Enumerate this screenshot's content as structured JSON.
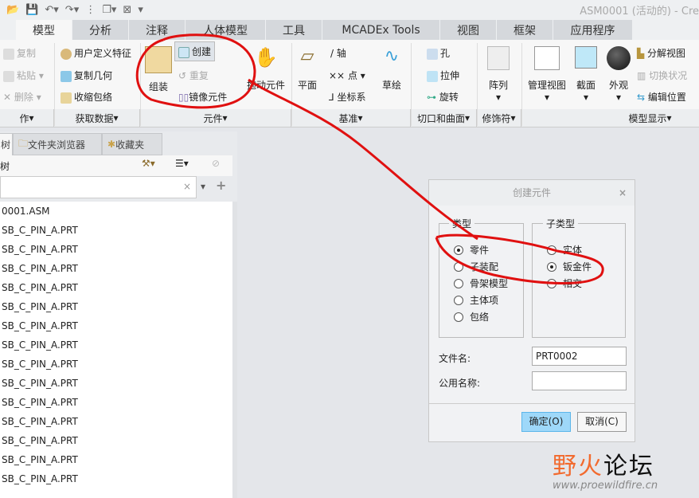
{
  "window": {
    "title": "ASM0001 (活动的) - Cre"
  },
  "tabs": [
    "模型",
    "分析",
    "注释",
    "人体模型",
    "工具",
    "MCADEx Tools",
    "视图",
    "框架",
    "应用程序"
  ],
  "ribbon": {
    "operations": {
      "copy": "复制",
      "paste": "粘贴",
      "delete": "删除",
      "footer": "作"
    },
    "get_data": {
      "udf": "用户定义特征",
      "copy_geom": "复制几何",
      "shrinkwrap": "收缩包络",
      "footer": "获取数据"
    },
    "component": {
      "assemble": "组装",
      "create": "创建",
      "repeat": "重复",
      "mirror": "镜像元件",
      "drag": "拖动元件",
      "footer": "元件"
    },
    "datum": {
      "plane": "平面",
      "axis": "轴",
      "point": "点",
      "csys": "坐标系",
      "sketch": "草绘",
      "footer": "基准"
    },
    "cut": {
      "hole": "孔",
      "extrude": "拉伸",
      "revolve": "旋转",
      "footer": "切口和曲面"
    },
    "modifier": {
      "pattern": "阵列",
      "footer": "修饰符"
    },
    "display": {
      "manage_views": "管理视图",
      "section": "截面",
      "appearance": "外观",
      "explode": "分解视图",
      "toggle": "切换状况",
      "edit_pos": "编辑位置",
      "footer": "模型显示"
    }
  },
  "panel": {
    "tabs": [
      "树",
      "文件夹浏览器",
      "收藏夹"
    ],
    "label": "树",
    "search_value": "",
    "root": "0001.ASM",
    "items": [
      "SB_C_PIN_A.PRT",
      "SB_C_PIN_A.PRT",
      "SB_C_PIN_A.PRT",
      "SB_C_PIN_A.PRT",
      "SB_C_PIN_A.PRT",
      "SB_C_PIN_A.PRT",
      "SB_C_PIN_A.PRT",
      "SB_C_PIN_A.PRT",
      "SB_C_PIN_A.PRT",
      "SB_C_PIN_A.PRT",
      "SB_C_PIN_A.PRT",
      "SB_C_PIN_A.PRT",
      "SB_C_PIN_A.PRT",
      "SB_C_PIN_A.PRT"
    ]
  },
  "dialog": {
    "title": "创建元件",
    "type_label": "类型",
    "types": [
      "零件",
      "子装配",
      "骨架模型",
      "主体项",
      "包络"
    ],
    "type_selected": 0,
    "subtype_label": "子类型",
    "subtypes": [
      "实体",
      "钣金件",
      "相交"
    ],
    "subtype_selected": 1,
    "file_name_label": "文件名:",
    "file_name": "PRT0002",
    "common_name_label": "公用名称:",
    "common_name": "",
    "ok": "确定(O)",
    "cancel": "取消(C)"
  },
  "watermark": {
    "brand": "野火论坛",
    "url": "www.proewildfire.cn"
  },
  "colors": {
    "ok_button": "#9ed8f9",
    "annotation": "#e01010",
    "brand": "#f26a2e"
  }
}
